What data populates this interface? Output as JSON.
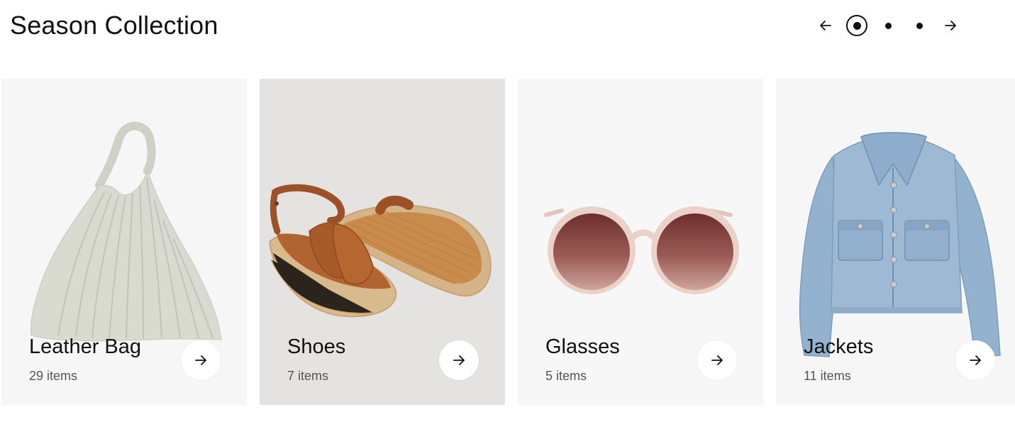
{
  "header": {
    "title": "Season Collection"
  },
  "pager": {
    "prev_icon": "arrow-left-icon",
    "next_icon": "arrow-right-icon",
    "pages": 3,
    "active_page": 1
  },
  "cards": [
    {
      "name": "Leather Bag",
      "count": "29 items",
      "icon": "arrow-right-icon",
      "bg": "#f6f6f6"
    },
    {
      "name": "Shoes",
      "count": "7 items",
      "icon": "arrow-right-icon",
      "bg": "#e4e3e2"
    },
    {
      "name": "Glasses",
      "count": "5 items",
      "icon": "arrow-right-icon",
      "bg": "#f7f7f7"
    },
    {
      "name": "Jackets",
      "count": "11 items",
      "icon": "arrow-right-icon",
      "bg": "#f6f6f6"
    }
  ]
}
